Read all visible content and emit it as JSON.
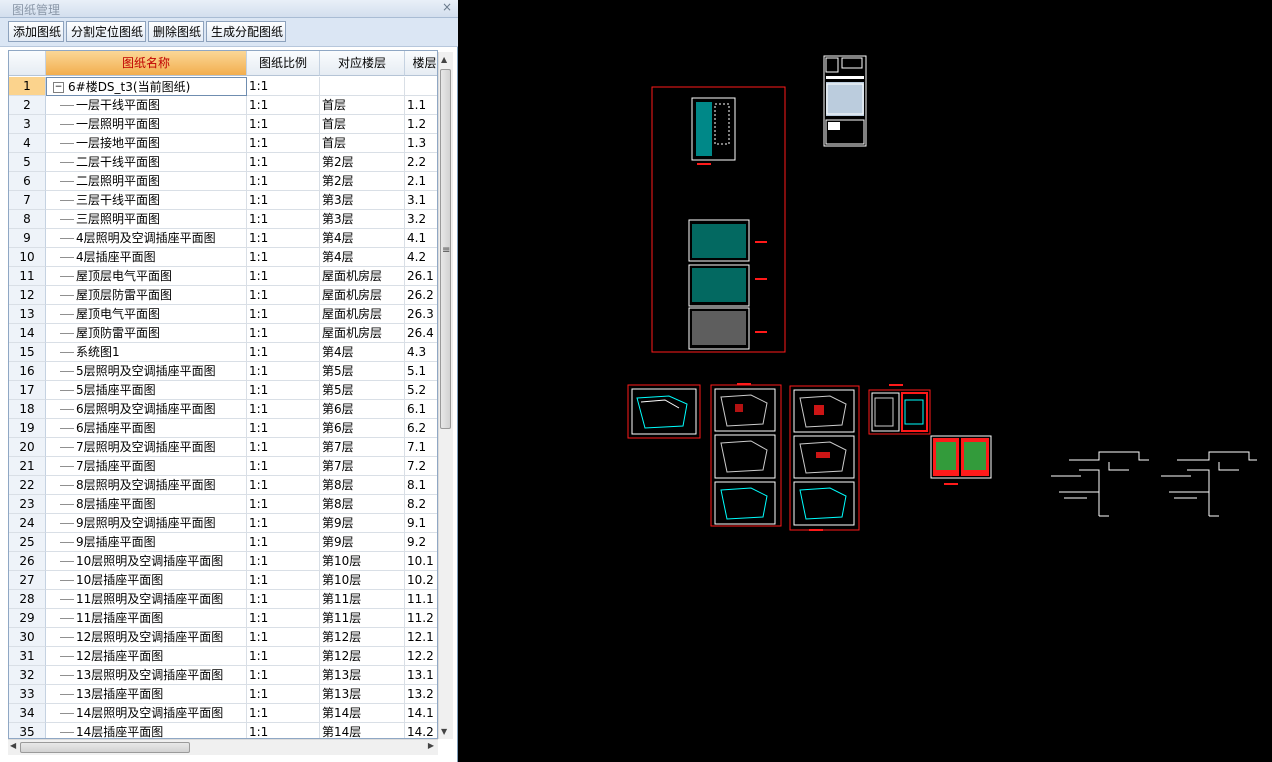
{
  "window": {
    "title": "图纸管理",
    "close_glyph": "×"
  },
  "toolbar": {
    "add": "添加图纸",
    "split": "分割定位图纸",
    "delete": "删除图纸",
    "generate": "生成分配图纸"
  },
  "columns": [
    "",
    "图纸名称",
    "图纸比例",
    "对应楼层",
    "楼层"
  ],
  "root": {
    "num": "1",
    "name": "6#楼DS_t3(当前图纸)",
    "scale": "1:1",
    "floor": "",
    "code": "",
    "expander": "−"
  },
  "rows": [
    {
      "num": "2",
      "name": "一层干线平面图",
      "scale": "1:1",
      "floor": "首层",
      "code": "1.1"
    },
    {
      "num": "3",
      "name": "一层照明平面图",
      "scale": "1:1",
      "floor": "首层",
      "code": "1.2"
    },
    {
      "num": "4",
      "name": "一层接地平面图",
      "scale": "1:1",
      "floor": "首层",
      "code": "1.3"
    },
    {
      "num": "5",
      "name": "二层干线平面图",
      "scale": "1:1",
      "floor": "第2层",
      "code": "2.2"
    },
    {
      "num": "6",
      "name": "二层照明平面图",
      "scale": "1:1",
      "floor": "第2层",
      "code": "2.1"
    },
    {
      "num": "7",
      "name": "三层干线平面图",
      "scale": "1:1",
      "floor": "第3层",
      "code": "3.1"
    },
    {
      "num": "8",
      "name": "三层照明平面图",
      "scale": "1:1",
      "floor": "第3层",
      "code": "3.2"
    },
    {
      "num": "9",
      "name": "4层照明及空调插座平面图",
      "scale": "1:1",
      "floor": "第4层",
      "code": "4.1"
    },
    {
      "num": "10",
      "name": "4层插座平面图",
      "scale": "1:1",
      "floor": "第4层",
      "code": "4.2"
    },
    {
      "num": "11",
      "name": "屋顶层电气平面图",
      "scale": "1:1",
      "floor": "屋面机房层",
      "code": "26.1"
    },
    {
      "num": "12",
      "name": "屋顶层防雷平面图",
      "scale": "1:1",
      "floor": "屋面机房层",
      "code": "26.2"
    },
    {
      "num": "13",
      "name": "屋顶电气平面图",
      "scale": "1:1",
      "floor": "屋面机房层",
      "code": "26.3"
    },
    {
      "num": "14",
      "name": "屋顶防雷平面图",
      "scale": "1:1",
      "floor": "屋面机房层",
      "code": "26.4"
    },
    {
      "num": "15",
      "name": "系统图1",
      "scale": "1:1",
      "floor": "第4层",
      "code": "4.3"
    },
    {
      "num": "16",
      "name": "5层照明及空调插座平面图",
      "scale": "1:1",
      "floor": "第5层",
      "code": "5.1"
    },
    {
      "num": "17",
      "name": "5层插座平面图",
      "scale": "1:1",
      "floor": "第5层",
      "code": "5.2"
    },
    {
      "num": "18",
      "name": "6层照明及空调插座平面图",
      "scale": "1:1",
      "floor": "第6层",
      "code": "6.1"
    },
    {
      "num": "19",
      "name": "6层插座平面图",
      "scale": "1:1",
      "floor": "第6层",
      "code": "6.2"
    },
    {
      "num": "20",
      "name": "7层照明及空调插座平面图",
      "scale": "1:1",
      "floor": "第7层",
      "code": "7.1"
    },
    {
      "num": "21",
      "name": "7层插座平面图",
      "scale": "1:1",
      "floor": "第7层",
      "code": "7.2"
    },
    {
      "num": "22",
      "name": "8层照明及空调插座平面图",
      "scale": "1:1",
      "floor": "第8层",
      "code": "8.1"
    },
    {
      "num": "23",
      "name": "8层插座平面图",
      "scale": "1:1",
      "floor": "第8层",
      "code": "8.2"
    },
    {
      "num": "24",
      "name": "9层照明及空调插座平面图",
      "scale": "1:1",
      "floor": "第9层",
      "code": "9.1"
    },
    {
      "num": "25",
      "name": "9层插座平面图",
      "scale": "1:1",
      "floor": "第9层",
      "code": "9.2"
    },
    {
      "num": "26",
      "name": "10层照明及空调插座平面图",
      "scale": "1:1",
      "floor": "第10层",
      "code": "10.1"
    },
    {
      "num": "27",
      "name": "10层插座平面图",
      "scale": "1:1",
      "floor": "第10层",
      "code": "10.2"
    },
    {
      "num": "28",
      "name": "11层照明及空调插座平面图",
      "scale": "1:1",
      "floor": "第11层",
      "code": "11.1"
    },
    {
      "num": "29",
      "name": "11层插座平面图",
      "scale": "1:1",
      "floor": "第11层",
      "code": "11.2"
    },
    {
      "num": "30",
      "name": "12层照明及空调插座平面图",
      "scale": "1:1",
      "floor": "第12层",
      "code": "12.1"
    },
    {
      "num": "31",
      "name": "12层插座平面图",
      "scale": "1:1",
      "floor": "第12层",
      "code": "12.2"
    },
    {
      "num": "32",
      "name": "13层照明及空调插座平面图",
      "scale": "1:1",
      "floor": "第13层",
      "code": "13.1"
    },
    {
      "num": "33",
      "name": "13层插座平面图",
      "scale": "1:1",
      "floor": "第13层",
      "code": "13.2"
    },
    {
      "num": "34",
      "name": "14层照明及空调插座平面图",
      "scale": "1:1",
      "floor": "第14层",
      "code": "14.1"
    },
    {
      "num": "35",
      "name": "14层插座平面图",
      "scale": "1:1",
      "floor": "第14层",
      "code": "14.2"
    }
  ],
  "colors": {
    "canvas_bg": "#000000",
    "frame_red": "#ff1a1a",
    "selected_header": "#f2ae4e",
    "cad_cyan": "#00ffff",
    "cad_white": "#ffffff"
  },
  "icons": {
    "scroll_up": "▲",
    "scroll_down": "▼",
    "scroll_left": "◀",
    "scroll_right": "▶",
    "grip": "≡"
  }
}
